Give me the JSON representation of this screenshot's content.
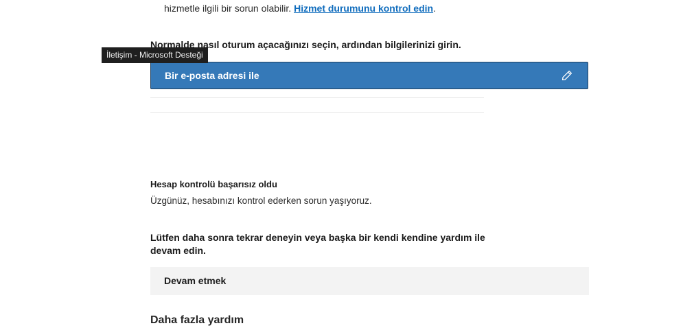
{
  "status_notice": {
    "text": "hizmetle ilgili bir sorun olabilir.",
    "link": "Hizmet durumunu kontrol edin",
    "end": "."
  },
  "signin": {
    "prompt": "Normalde nasıl oturum açacağınızı seçin, ardından bilgilerinizi girin.",
    "option_label": "Bir e-posta adresi ile"
  },
  "tooltip": {
    "text": "İletişim - Microsoft Desteği"
  },
  "error": {
    "title": "Hesap kontrolü başarısız oldu",
    "message": "Üzgünüz, hesabınızı kontrol ederken sorun yaşıyoruz."
  },
  "retry": {
    "text": "Lütfen daha sonra tekrar deneyin veya başka bir kendi kendine yardım ile devam edin.",
    "continue_label": "Devam etmek"
  },
  "more_help": {
    "title": "Daha fazla yardım"
  },
  "colors": {
    "accent": "#3579b8",
    "link": "#0f6cbd",
    "button_bg": "#f3f3f3"
  }
}
